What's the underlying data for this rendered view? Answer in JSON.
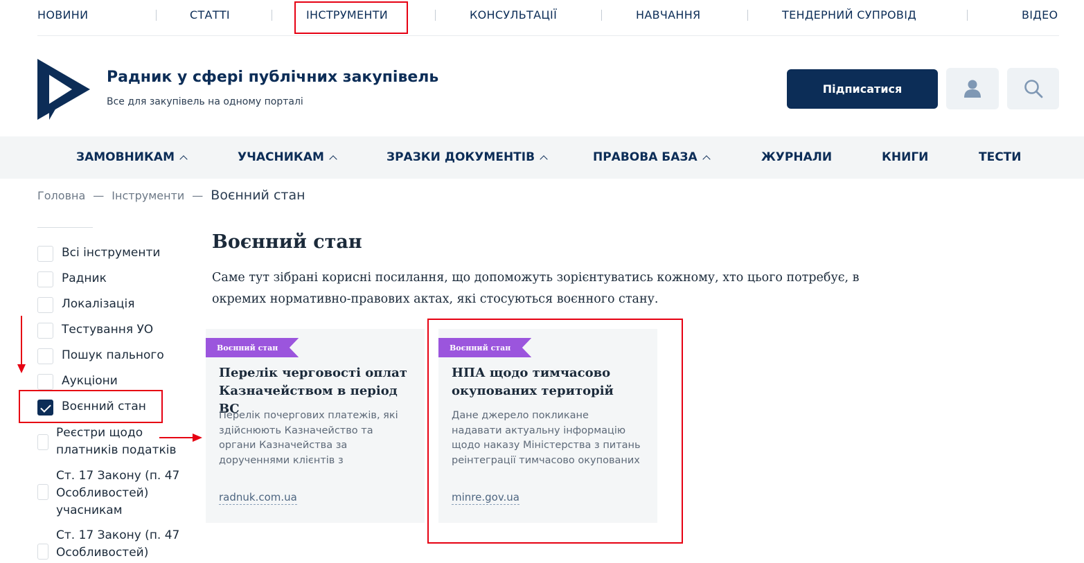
{
  "topnav": {
    "items": [
      "НОВИНИ",
      "СТАТТІ",
      "ІНСТРУМЕНТИ",
      "КОНСУЛЬТАЦІЇ",
      "НАВЧАННЯ",
      "ТЕНДЕРНИЙ СУПРОВІД",
      "ВІДЕО"
    ]
  },
  "header": {
    "title": "Радник у сфері публічних закупівель",
    "subtitle": "Все для закупівель на одному порталі",
    "subscribe_label": "Підписатися",
    "user_icon": "user-icon",
    "search_icon": "search-icon"
  },
  "mainmenu": {
    "items": [
      "ЗАМОВНИКАМ",
      "УЧАСНИКАМ",
      "ЗРАЗКИ ДОКУМЕНТІВ",
      "ПРАВОВА БАЗА",
      "ЖУРНАЛИ",
      "КНИГИ",
      "ТЕСТИ"
    ]
  },
  "breadcrumb": {
    "home": "Головна",
    "sep": "—",
    "section": "Інструменти",
    "current": "Воєнний стан"
  },
  "filters": [
    {
      "label": "Всі інструменти",
      "checked": false
    },
    {
      "label": "Радник",
      "checked": false
    },
    {
      "label": "Локалізація",
      "checked": false
    },
    {
      "label": "Тестування УО",
      "checked": false
    },
    {
      "label": "Пошук пального",
      "checked": false
    },
    {
      "label": "Аукціони",
      "checked": false
    },
    {
      "label": "Воєнний стан",
      "checked": true
    },
    {
      "label_lines": [
        "Реєстри щодо",
        "платників податків"
      ],
      "checked": false
    },
    {
      "label_lines": [
        "Ст. 17 Закону (п. 47",
        "Особливостей)",
        "учасникам"
      ],
      "checked": false
    },
    {
      "label_lines": [
        "Ст. 17 Закону (п. 47",
        "Особливостей)"
      ],
      "checked": false
    }
  ],
  "content": {
    "heading": "Воєнний стан",
    "intro": "Саме тут зібрані корисні посилання, що допоможуть зорієнтуватись кожному, хто цього потребує, в окремих нормативно-правових актах, які стосуються воєнного стану."
  },
  "cards": [
    {
      "tag": "Воєнний стан",
      "title": "Перелік черговості оплат Казначейством в період ВС",
      "description": "Перелік почергових платежів, які здійснюють Казначейство та органи Казначейства за дорученнями клієнтів з",
      "link": "radnuk.com.ua"
    },
    {
      "tag": "Воєнний стан",
      "title": "НПА щодо тимчасово окупованих територій",
      "description": "Дане джерело покликане надавати актуальну інформацію щодо наказу Міністерства з питань реінтеграції тимчасово окупованих",
      "link": "minre.gov.ua"
    }
  ],
  "colors": {
    "brand": "#0c2d57",
    "tag": "#9b55dd",
    "annotation": "#e60012"
  }
}
